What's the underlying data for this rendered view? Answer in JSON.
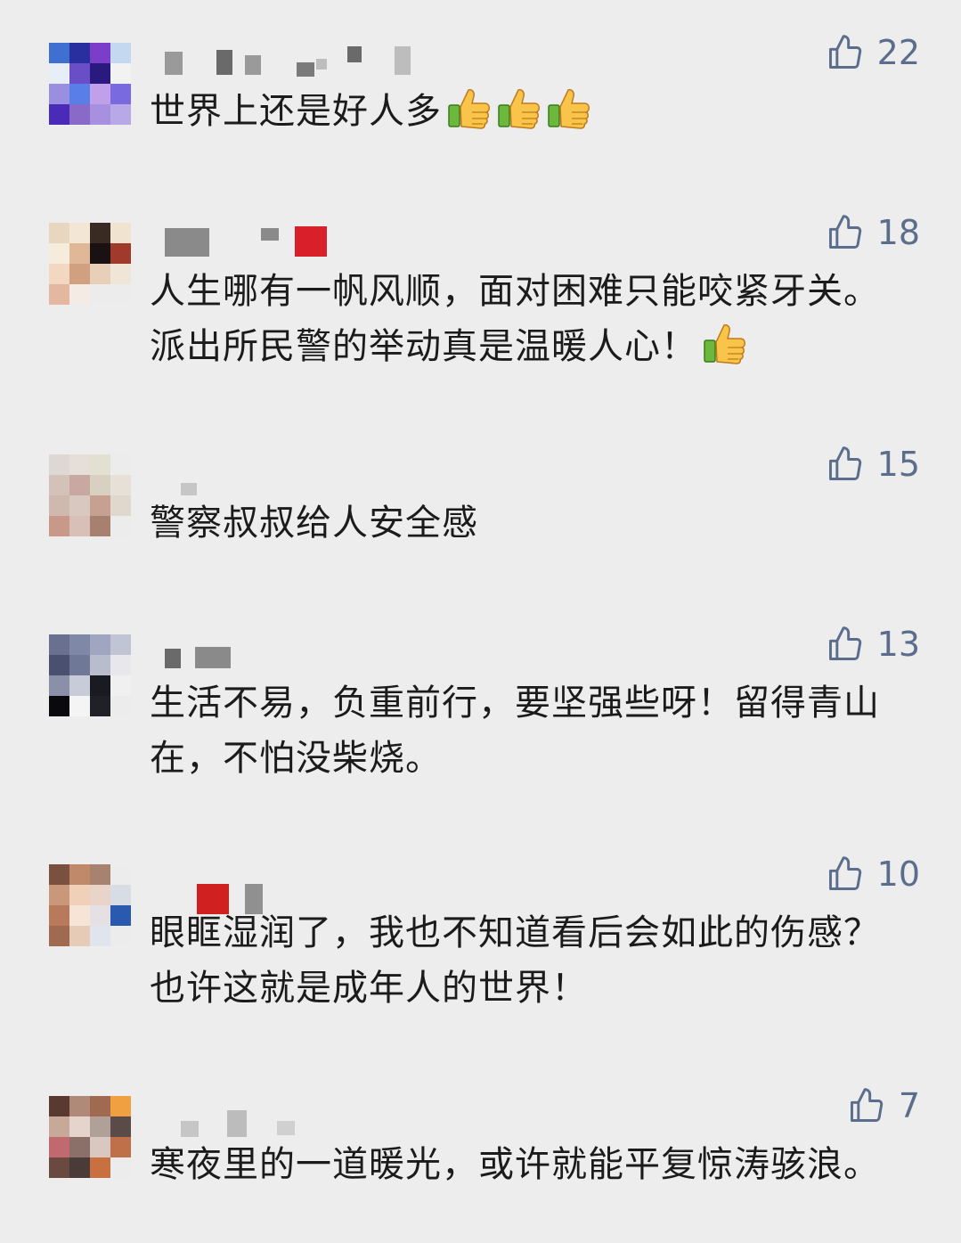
{
  "comments": [
    {
      "likes": "22",
      "text": "世界上还是好人多",
      "emoji_count": 3,
      "avatar": [
        "#3f6fd0",
        "#2a2fa0",
        "#7a3ec8",
        "#c4d8f0",
        "#e8eef8",
        "#6a4ec8",
        "#2a1a80",
        "#f2f2f2",
        "#9a8ee0",
        "#5a7ee8",
        "#c0a0e8",
        "#7a6ae0",
        "#4a2ab8",
        "#8a6ac8",
        "#a890e0",
        "#b8a8e8"
      ]
    },
    {
      "likes": "18",
      "text": "人生哪有一帆风顺，面对困难只能咬紧牙关。派出所民警的举动真是温暖人心！",
      "emoji_count": 1,
      "avatar": [
        "#e8d6c0",
        "#f4e6d4",
        "#3a2a24",
        "#f0e4d0",
        "#f6ecdc",
        "#e0b898",
        "#1a1212",
        "#a03a2a",
        "#f2d8c0",
        "#d0a080",
        "#e8d0b8",
        "#f0e6d8",
        "#e4b8a0",
        "#f4ece4",
        "#ececec",
        "#ececec"
      ]
    },
    {
      "likes": "15",
      "text": "警察叔叔给人安全感",
      "emoji_count": 0,
      "avatar": [
        "#ddd8d4",
        "#e6ded8",
        "#e2e0d0",
        "#ececec",
        "#d4c2b8",
        "#c8a8a0",
        "#d8d0c0",
        "#e6e0d6",
        "#cfb8ae",
        "#d8c8c0",
        "#c6a090",
        "#e0d8cc",
        "#c89888",
        "#d8c0b8",
        "#a88070",
        "#ececec"
      ]
    },
    {
      "likes": "13",
      "text": "生活不易，负重前行，要坚强些呀！留得青山在，不怕没柴烧。",
      "emoji_count": 0,
      "avatar": [
        "#6a7090",
        "#8088a8",
        "#a0a6c0",
        "#c0c4d4",
        "#4a5070",
        "#707898",
        "#b8bccc",
        "#e8e8ec",
        "#8a90a8",
        "#c8ccd8",
        "#1a1a22",
        "#f0f0f0",
        "#0a0a0e",
        "#f4f4f4",
        "#202028",
        "#ececec"
      ]
    },
    {
      "likes": "10",
      "text": "眼眶湿润了，我也不知道看后会如此的伤感？也许这就是成年人的世界！",
      "emoji_count": 0,
      "avatar": [
        "#7a5040",
        "#c08a6a",
        "#a88270",
        "#ececec",
        "#c89878",
        "#f0d0b8",
        "#e8d4c8",
        "#d8dce4",
        "#b87a5a",
        "#f6e4d6",
        "#e4e0e4",
        "#2a5ab0",
        "#a06a50",
        "#e6ccb6",
        "#e0e4ec",
        "#ececec"
      ]
    },
    {
      "likes": "7",
      "text": "寒夜里的一道暖光，或许就能平复惊涛骇浪。",
      "emoji_count": 0,
      "avatar": [
        "#5a3a30",
        "#b08a78",
        "#a06a50",
        "#f0a040",
        "#c8a898",
        "#e4d4cc",
        "#b0a098",
        "#5a4a48",
        "#c06a70",
        "#8a7068",
        "#d8c8c0",
        "#c07048",
        "#6a4a40",
        "#4a3a38",
        "#c87040",
        "#ececec"
      ]
    }
  ]
}
